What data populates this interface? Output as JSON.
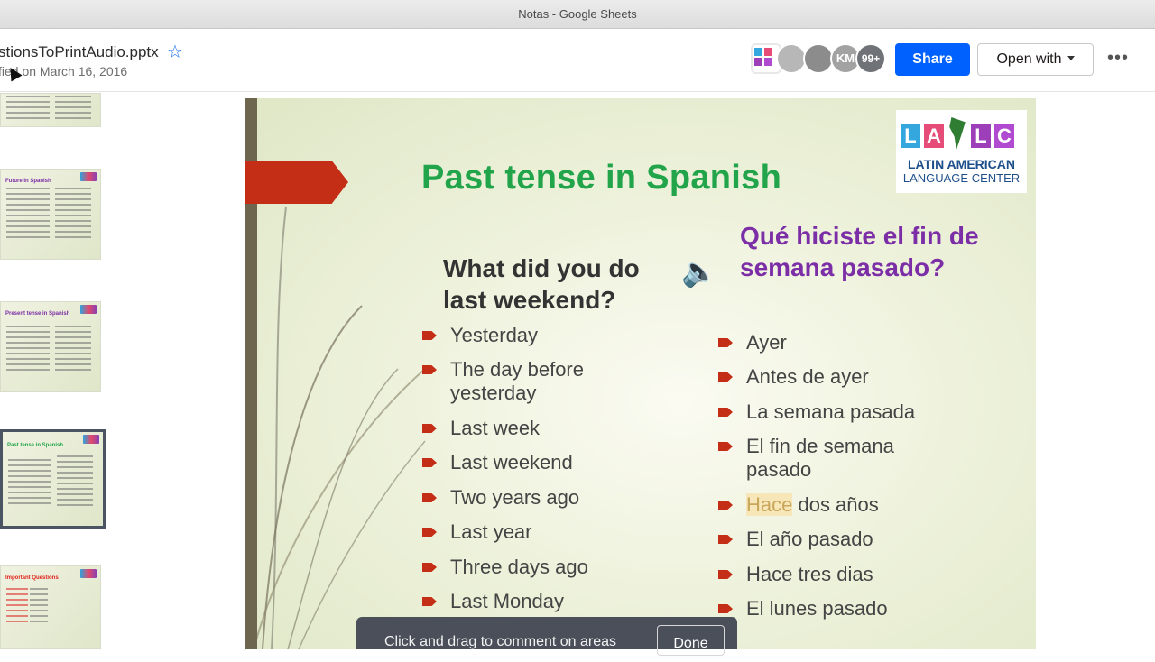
{
  "window": {
    "title": "Notas - Google Sheets"
  },
  "header": {
    "file_name": "stionsToPrintAudio.pptx",
    "modified": "fied on March 16, 2016",
    "avatars": [
      "KM",
      "99+"
    ],
    "share_label": "Share",
    "open_with_label": "Open with",
    "more_label": "•••"
  },
  "sidebar": {
    "thumbs": [
      {
        "title": ""
      },
      {
        "title": "Future in Spanish"
      },
      {
        "title": "Present tense in Spanish"
      },
      {
        "title": "Past tense in Spanish"
      },
      {
        "title": "Important Questions"
      }
    ]
  },
  "slide": {
    "title": "Past tense in Spanish",
    "logo_line1": "LATIN AMERICAN",
    "logo_line2": "LANGUAGE CENTER",
    "logo_letters": [
      "L",
      "A",
      "L",
      "C"
    ],
    "question_en": "What did you do last weekend?",
    "question_es": "Qué hiciste el fin de semana pasado?",
    "list_en": [
      "Yesterday",
      "The day before yesterday",
      "Last week",
      "Last weekend",
      "Two years ago",
      "Last year",
      "Three days ago",
      "Last Monday"
    ],
    "list_es_highlight": "Hace",
    "list_es_rest": " dos años",
    "list_es": [
      "Ayer",
      "Antes de ayer",
      "La semana pasada",
      "El fin de semana pasado",
      "Hace dos años",
      "El año pasado",
      "Hace tres dias",
      "El lunes pasado"
    ]
  },
  "toast": {
    "text": "Click and drag to comment on areas",
    "done_label": "Done"
  },
  "colors": {
    "share_blue": "#0061fe",
    "title_green": "#22a44a",
    "question_purple": "#7b2ea6",
    "bullet_red": "#c42e16"
  }
}
